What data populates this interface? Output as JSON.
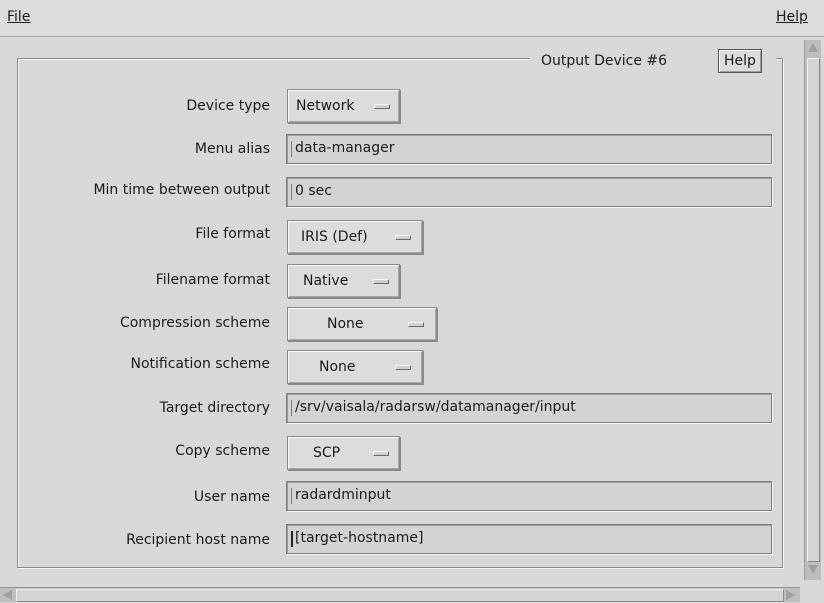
{
  "menubar": {
    "file_label": "File",
    "help_label": "Help"
  },
  "panel": {
    "title": "Output Device #6",
    "help_button": "Help"
  },
  "fields": {
    "device_type": {
      "label": "Device type",
      "value": "Network"
    },
    "menu_alias": {
      "label": "Menu alias",
      "value": "data-manager"
    },
    "min_time": {
      "label": "Min time between output",
      "value": "0 sec"
    },
    "file_format": {
      "label": "File format",
      "value": "IRIS (Def)"
    },
    "filename_format": {
      "label": "Filename format",
      "value": "Native"
    },
    "compression_scheme": {
      "label": "Compression scheme",
      "value": "None"
    },
    "notification_scheme": {
      "label": "Notification scheme",
      "value": "None"
    },
    "target_directory": {
      "label": "Target directory",
      "value": "/srv/vaisala/radarsw/datamanager/input"
    },
    "copy_scheme": {
      "label": "Copy scheme",
      "value": "SCP"
    },
    "user_name": {
      "label": "User name",
      "value": "radardminput"
    },
    "recipient_host": {
      "label": "Recipient host name",
      "value": "[target-hostname]"
    }
  }
}
